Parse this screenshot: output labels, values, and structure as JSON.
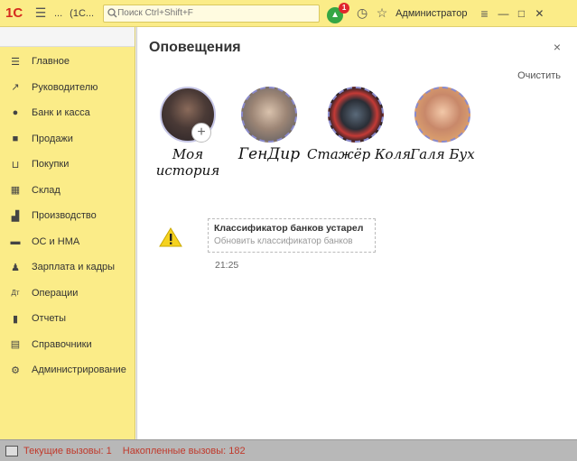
{
  "topbar": {
    "logo": "1С",
    "ellipsis": "...",
    "window_title": "(1С...",
    "search_placeholder": "Поиск Ctrl+Shift+F",
    "notification_count": "1",
    "user": "Администратор"
  },
  "sidebar": {
    "items": [
      {
        "label": "Главное",
        "icon": "menu-icon"
      },
      {
        "label": "Руководителю",
        "icon": "trend-icon"
      },
      {
        "label": "Банк и касса",
        "icon": "bank-icon"
      },
      {
        "label": "Продажи",
        "icon": "bag-icon"
      },
      {
        "label": "Покупки",
        "icon": "cart-icon"
      },
      {
        "label": "Склад",
        "icon": "warehouse-icon"
      },
      {
        "label": "Производство",
        "icon": "factory-icon"
      },
      {
        "label": "ОС и НМА",
        "icon": "truck-icon"
      },
      {
        "label": "Зарплата и кадры",
        "icon": "person-icon"
      },
      {
        "label": "Операции",
        "icon": "operations-icon"
      },
      {
        "label": "Отчеты",
        "icon": "chart-icon"
      },
      {
        "label": "Справочники",
        "icon": "book-icon"
      },
      {
        "label": "Администрирование",
        "icon": "gear-icon"
      }
    ]
  },
  "panel": {
    "title": "Оповещения",
    "close": "×",
    "clear": "Очистить",
    "stories": [
      {
        "name_line1": "Моя",
        "name_line2": "история"
      },
      {
        "name_line1": "ГенДир",
        "name_line2": ""
      },
      {
        "name_line1": "Стажёр Коля",
        "name_line2": ""
      },
      {
        "name_line1": "Галя Бух",
        "name_line2": ""
      }
    ],
    "notification": {
      "title": "Классификатор банков устарел",
      "subtitle": "Обновить классификатор банков",
      "time": "21:25"
    }
  },
  "statusbar": {
    "current_calls": "Текущие вызовы: 1",
    "accumulated_calls": "Накопленные вызовы: 182"
  },
  "colors": {
    "accent_yellow": "#fbec88",
    "logo_red": "#d52b1e",
    "status_red": "#c0392b",
    "bell_green": "#35a644"
  }
}
